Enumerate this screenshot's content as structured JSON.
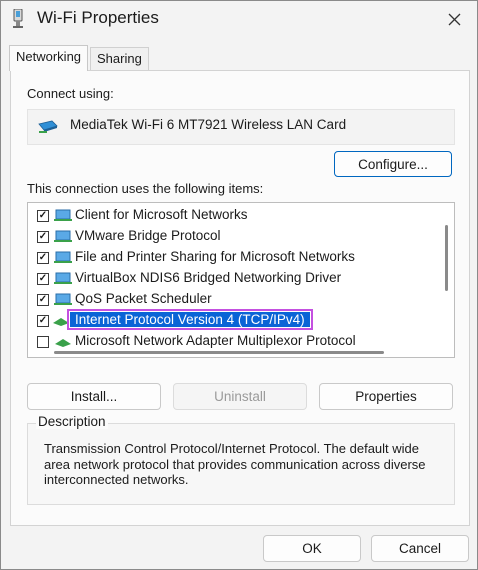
{
  "window": {
    "title": "Wi-Fi Properties"
  },
  "tabs": [
    {
      "label": "Networking"
    },
    {
      "label": "Sharing"
    }
  ],
  "connect_using": {
    "label": "Connect using:",
    "adapter": "MediaTek Wi-Fi 6 MT7921 Wireless LAN Card",
    "configure_label": "Configure..."
  },
  "items": {
    "label": "This connection uses the following items:",
    "list": [
      {
        "label": "Client for Microsoft Networks",
        "checked": true
      },
      {
        "label": "VMware Bridge Protocol",
        "checked": true
      },
      {
        "label": "File and Printer Sharing for Microsoft Networks",
        "checked": true
      },
      {
        "label": "VirtualBox NDIS6 Bridged Networking Driver",
        "checked": true
      },
      {
        "label": "QoS Packet Scheduler",
        "checked": true
      },
      {
        "label": "Internet Protocol Version 4 (TCP/IPv4)",
        "checked": true,
        "selected": true
      },
      {
        "label": "Microsoft Network Adapter Multiplexor Protocol",
        "checked": false
      }
    ]
  },
  "actions": {
    "install": "Install...",
    "uninstall": "Uninstall",
    "properties": "Properties"
  },
  "description": {
    "title": "Description",
    "text": "Transmission Control Protocol/Internet Protocol. The default wide area network protocol that provides communication across diverse interconnected networks."
  },
  "footer": {
    "ok": "OK",
    "cancel": "Cancel"
  },
  "colors": {
    "selection": "#0a64d6",
    "highlight_outline": "#c450e0",
    "primary_border": "#0067c0"
  }
}
